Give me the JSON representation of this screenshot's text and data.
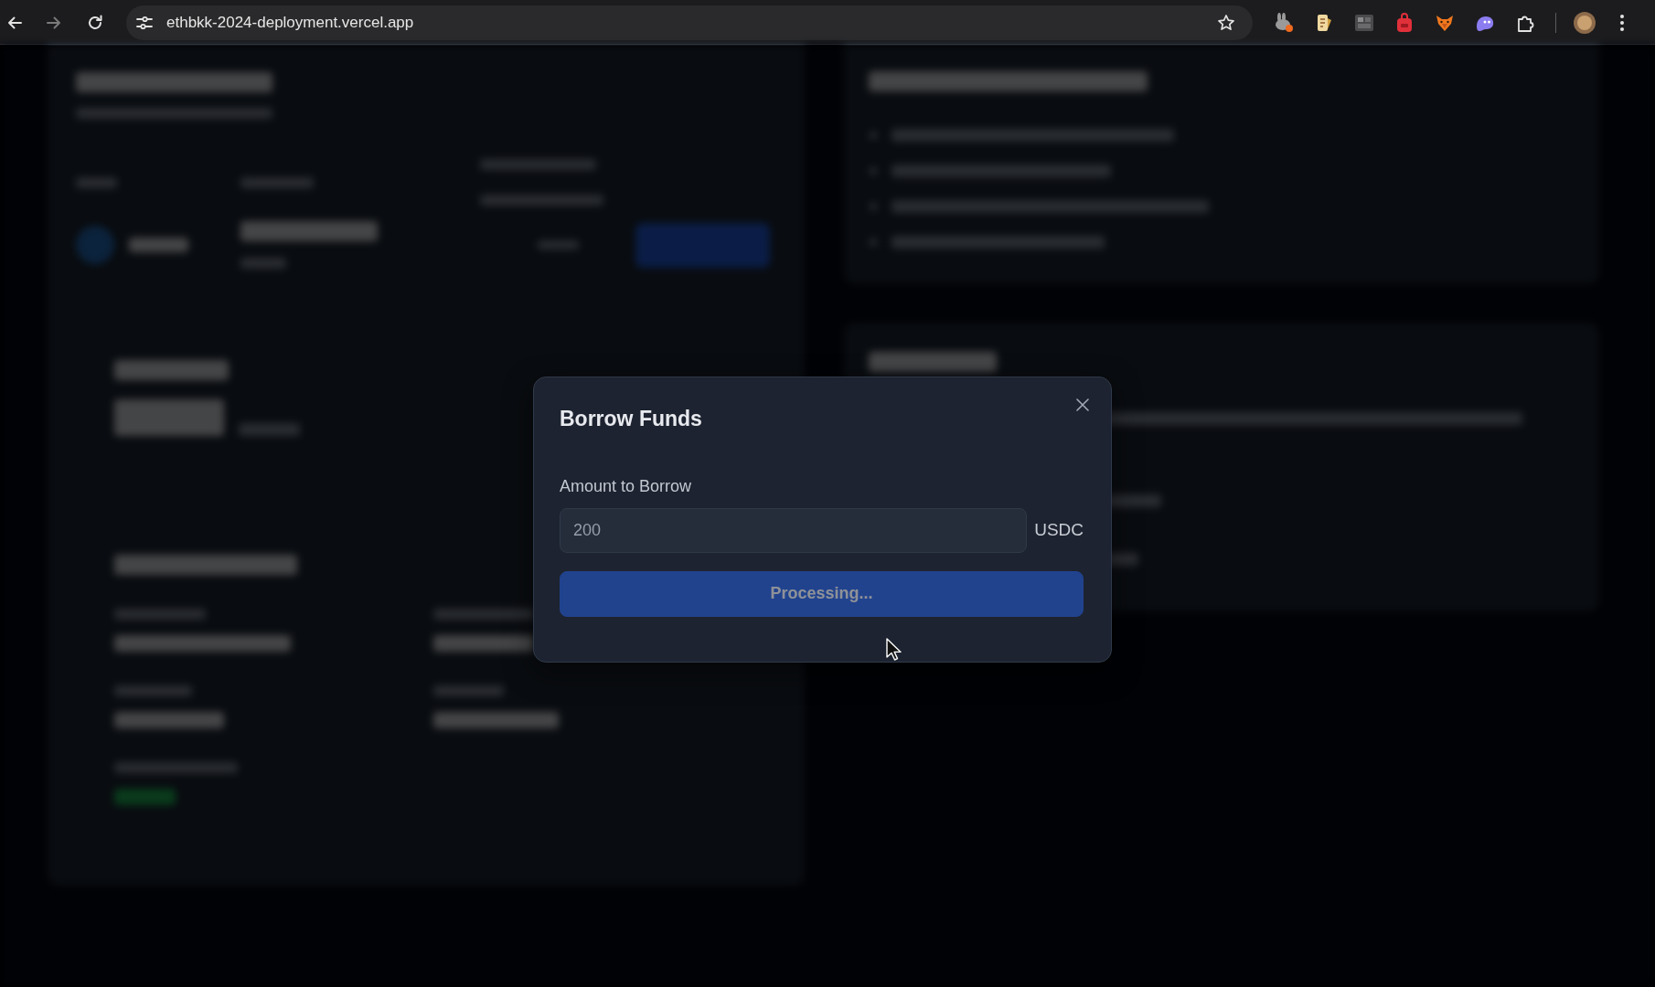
{
  "browser": {
    "url": "ethbkk-2024-deployment.vercel.app"
  },
  "modal": {
    "title": "Borrow Funds",
    "field": {
      "label": "Amount to Borrow",
      "value": "200",
      "unit": "USDC",
      "disabled": true
    },
    "button": {
      "label": "Processing...",
      "disabled": true
    }
  }
}
